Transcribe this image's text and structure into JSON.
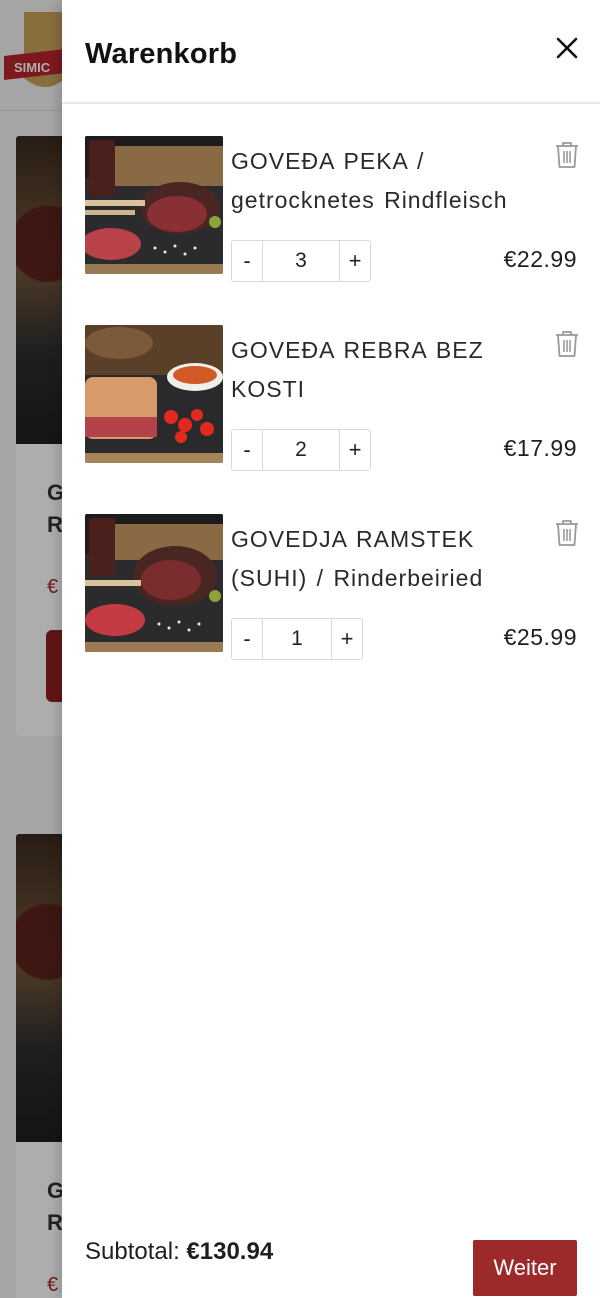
{
  "cart": {
    "title": "Warenkorb",
    "items": [
      {
        "name": "GOVEĐA PEKA / getrocknetes Rindfleisch",
        "quantity": "3",
        "price": "€22.99"
      },
      {
        "name": "GOVEĐA REBRA BEZ KOSTI",
        "quantity": "2",
        "price": "€17.99"
      },
      {
        "name": "GOVEDJA RAMSTEK (SUHI) / Rinderbeiried",
        "quantity": "1",
        "price": "€25.99"
      }
    ],
    "minus_label": "-",
    "plus_label": "+",
    "subtotal_label": "Subtotal:",
    "subtotal_value": "€130.94",
    "checkout_label": "Weiter"
  },
  "background": {
    "card_title_initials": [
      "G",
      "R"
    ],
    "price_initial": "€"
  },
  "colors": {
    "accent": "#9c2a2a",
    "overlay": "rgba(0,0,0,0.32)"
  },
  "icons": {
    "close": "close-icon",
    "delete": "trash-icon",
    "logo": "brand-logo"
  }
}
